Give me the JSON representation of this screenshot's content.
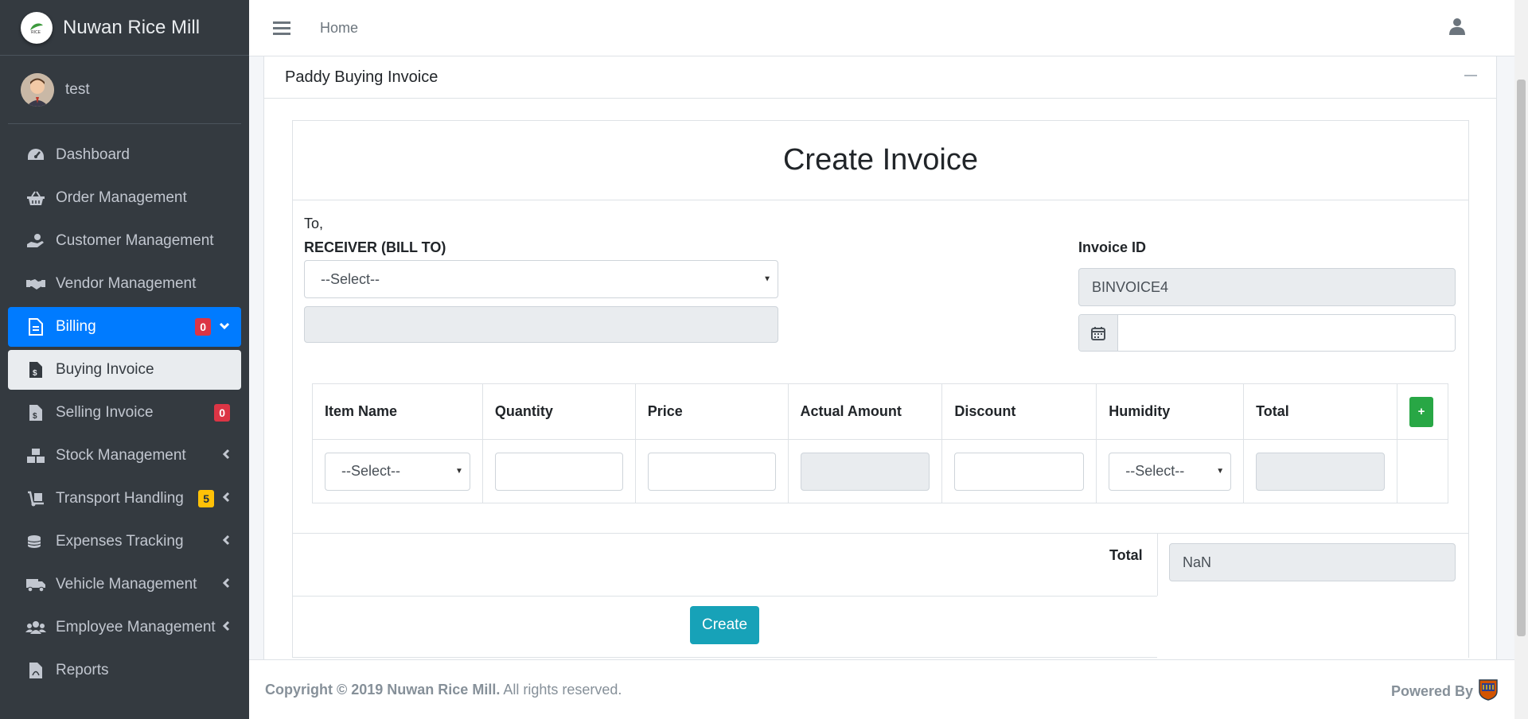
{
  "brand": {
    "name": "Nuwan Rice Mill"
  },
  "user": {
    "name": "test"
  },
  "topbar": {
    "home": "Home"
  },
  "sidebar": {
    "items": [
      {
        "label": "Dashboard",
        "icon": "dashboard-icon"
      },
      {
        "label": "Order Management",
        "icon": "basket-icon"
      },
      {
        "label": "Customer Management",
        "icon": "hand-holding-dollar-icon"
      },
      {
        "label": "Vendor Management",
        "icon": "handshake-icon"
      },
      {
        "label": "Billing",
        "icon": "file-icon",
        "badge": "0"
      },
      {
        "label": "Buying Invoice",
        "icon": "invoice-dollar-icon"
      },
      {
        "label": "Selling Invoice",
        "icon": "invoice-icon",
        "badge": "0"
      },
      {
        "label": "Stock Management",
        "icon": "boxes-icon"
      },
      {
        "label": "Transport Handling",
        "icon": "dolly-icon",
        "badge": "5"
      },
      {
        "label": "Expenses Tracking",
        "icon": "coins-icon"
      },
      {
        "label": "Vehicle Management",
        "icon": "truck-icon"
      },
      {
        "label": "Employee Management",
        "icon": "users-icon"
      },
      {
        "label": "Reports",
        "icon": "pdf-file-icon"
      }
    ]
  },
  "card": {
    "title": "Paddy Buying Invoice"
  },
  "invoice": {
    "heading": "Create Invoice",
    "to": "To,",
    "receiver_label": "RECEIVER (BILL TO)",
    "receiver_select": "--Select--",
    "invoice_id_label": "Invoice ID",
    "invoice_id": "BINVOICE4",
    "date_value": ""
  },
  "table": {
    "headers": [
      "Item Name",
      "Quantity",
      "Price",
      "Actual Amount",
      "Discount",
      "Humidity",
      "Total"
    ],
    "add_label": "+",
    "row": {
      "item_select": "--Select--",
      "humidity_select": "--Select--"
    }
  },
  "totals": {
    "label": "Total",
    "value": "NaN"
  },
  "buttons": {
    "create": "Create"
  },
  "footer": {
    "copyright_bold": "Copyright © 2019 Nuwan Rice Mill.",
    "copyright_rest": " All rights reserved.",
    "powered": "Powered By"
  },
  "colors": {
    "sidebar": "#343a40",
    "active": "#007bff",
    "create": "#17a2b8",
    "add": "#28a745"
  }
}
